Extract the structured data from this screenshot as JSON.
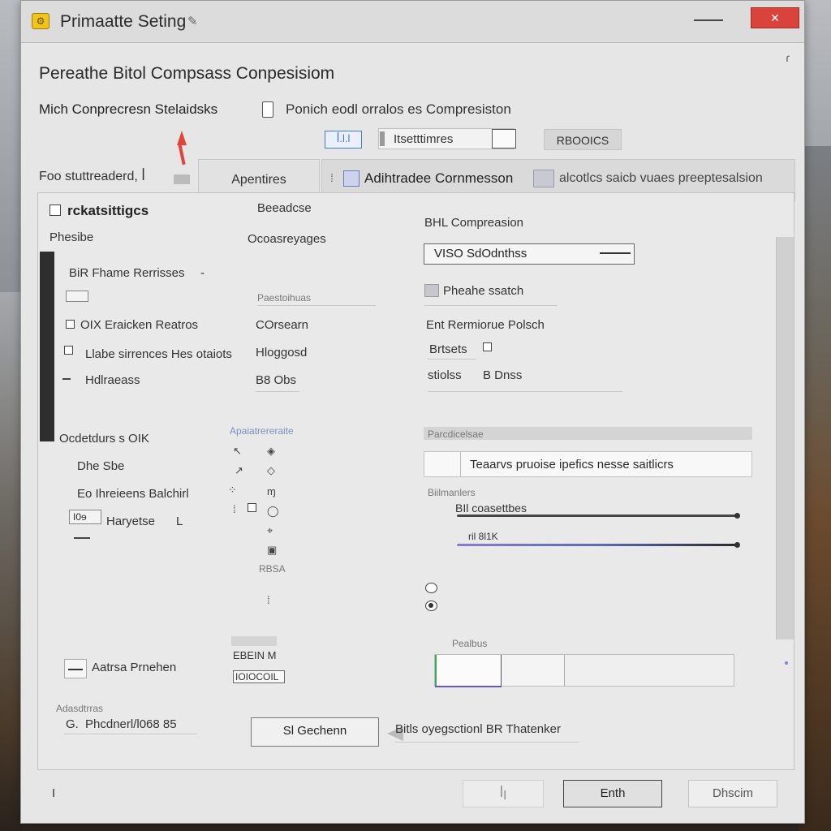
{
  "window": {
    "title": "Primaatte Seting",
    "title_pen": "✎",
    "close_symbol": "✕",
    "corner_mark": "ɾ"
  },
  "dialog": {
    "title": "Pereathe Bitol Compsass Conpesisiom",
    "subheader_left": "Mich Conprecresn Stelaidsks",
    "subheader_right": "Ponich eodl orralos es Compresiston"
  },
  "toolbar": {
    "a_label": "ꟾ.l.l",
    "b_label": "Itsetttimres",
    "d_label": "RBOOICS"
  },
  "for_label": "Foo stuttreaderd, ꟾ",
  "tabs": {
    "tab1": "Apentires",
    "tab2_mark": "⁞",
    "tab2_label": "Adihtradee Cornmesson",
    "tab2_desc": "alcotlcs saicb vuaes preeptesalsion"
  },
  "left_panel": {
    "header": "rckatsittigcs",
    "phesibe": "Phesibe",
    "bit_frame": "BiR Fhame Rerrisses",
    "dash_mark": "-",
    "row1_label": "OIX Eraicken Reatros",
    "row2_label": "Llabe sirrences Hes otaiots",
    "row3_label": "Hdlraeass",
    "row3_dash": "-",
    "oddness": "Ocdetdurs s OIK",
    "dhe_sbe": "Dhe Sbe",
    "eo_label": "Eo Ihreieens Balchirl",
    "io_box": "I0ɘ",
    "haryethe": "Haryetse",
    "haryethe_mark": "L",
    "advanced_toggle": "Aatrsa Prnehen",
    "adv_small": "Adasdtrras",
    "adv_prefix": "G.",
    "pipeline": "Phcdnerl/l068 85"
  },
  "mid_column": {
    "breadcoise": "Beeadcse",
    "ocorrespeycrs": "Ocoasreyages",
    "small_header": "Paestoihuas",
    "ocorsam": "COrsearn",
    "hippopsd": "Hloggosd",
    "b_obs": "B8 Obs",
    "small_header_2": "Apaiatrereraite",
    "glyphs": [
      "↖",
      "◈",
      "↗",
      "◇",
      "⁘",
      "ɱ",
      "⁞",
      "◯",
      "⌖",
      "▣",
      "⁞"
    ],
    "rbsa": "RBSA",
    "eebe_label": "EBEIN M",
    "eebe_input": "IOIOCOIL"
  },
  "right_column": {
    "bit_compression": "BHL Compreasion",
    "select_value": "VISO SdOdnthss",
    "checkbox_label": "Pheahe ssatch",
    "bit_remove": "Ent Rermiorue Polsch",
    "bitsets": "Brtsets",
    "stosh": "stiolss",
    "b_dross": "B Dnss",
    "strip_label": "Parcdicelsae",
    "result_text": "Teaarvs pruoise ipefics nesse saitlicrs",
    "small_label": "Biilmanlers",
    "slider1_label": "BIl coasettbes",
    "slider2_label": "ril 8l1K",
    "progress_label": "Pealbus",
    "check_button": "Sl Gechenn",
    "check_caption": "Bitls oyegsctionl BR Thatenker"
  },
  "footer": {
    "left_mark": "I",
    "btn1": "ꟾꞁ",
    "btn2": "Enth",
    "btn3": "Dhscim"
  }
}
